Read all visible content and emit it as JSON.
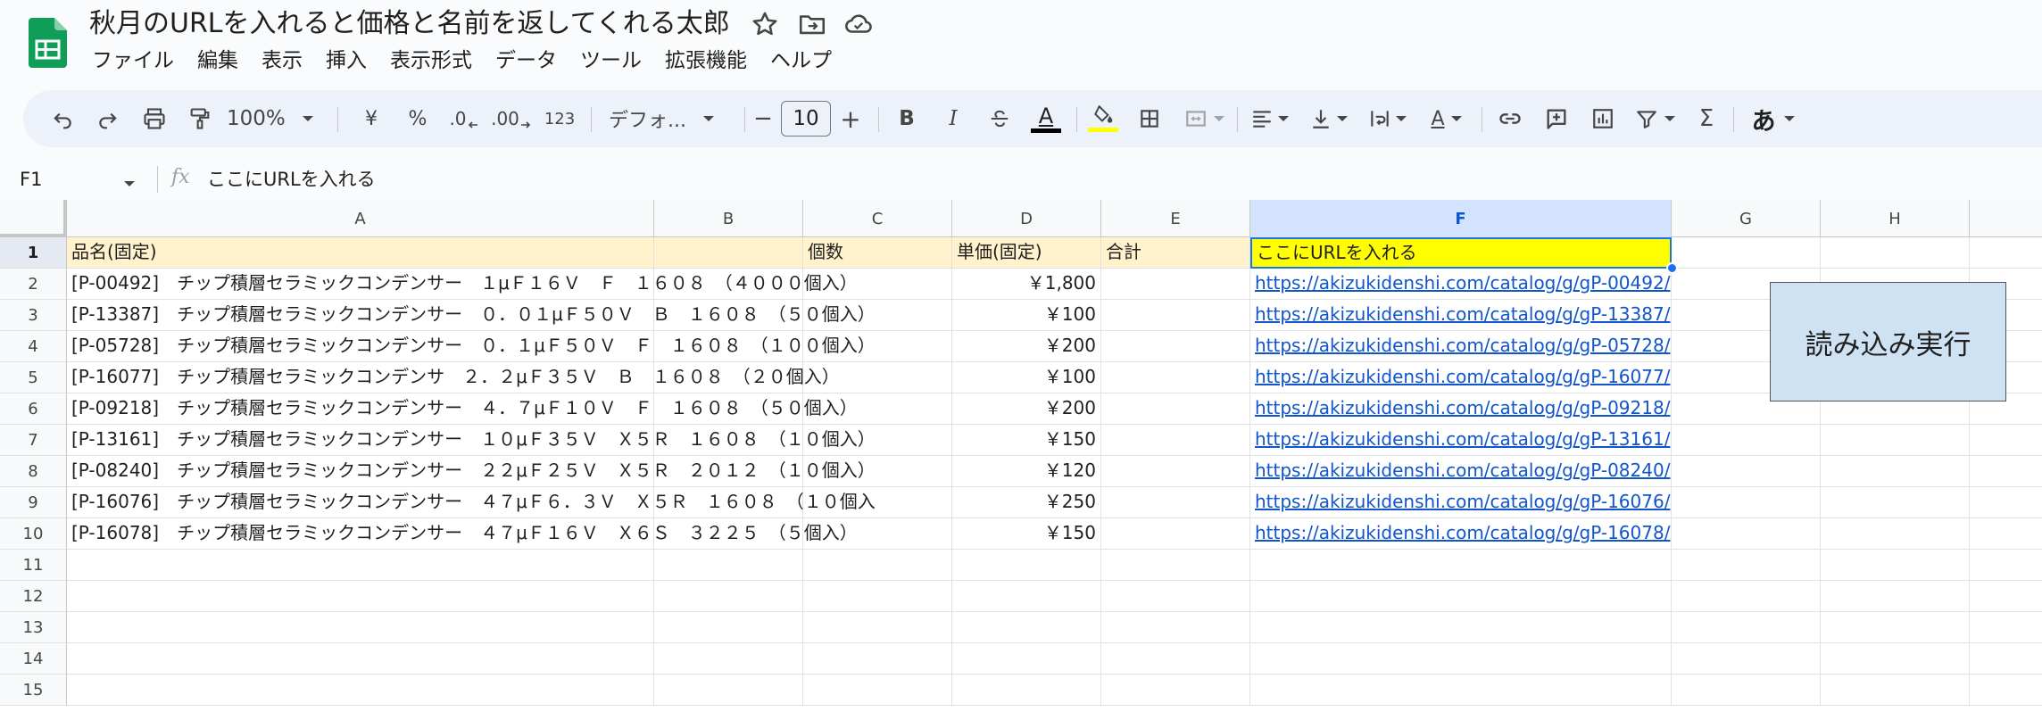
{
  "document": {
    "title": "秋月のURLを入れると価格と名前を返してくれる太郎"
  },
  "menu": [
    "ファイル",
    "編集",
    "表示",
    "挿入",
    "表示形式",
    "データ",
    "ツール",
    "拡張機能",
    "ヘルプ"
  ],
  "toolbar": {
    "zoom": "100%",
    "currency": "¥",
    "percent": "%",
    "decimal_decrease": ".0",
    "decimal_increase": ".00",
    "format_123": "123",
    "font_name": "デフォ...",
    "font_size": "10",
    "minus": "−",
    "plus": "+",
    "bold": "B",
    "italic": "I",
    "text_color_label": "A",
    "text_color": "#000000",
    "fill_color": "#ffff00",
    "rotate_label": "A",
    "sigma": "Σ",
    "input_tool": "あ"
  },
  "formula_bar": {
    "cell_ref": "F1",
    "fx": "fx",
    "value": "ここにURLを入れる"
  },
  "columns": [
    "A",
    "B",
    "C",
    "D",
    "E",
    "F",
    "G",
    "H"
  ],
  "selected_column": "F",
  "row_numbers": [
    "1",
    "2",
    "3",
    "4",
    "5",
    "6",
    "7",
    "8",
    "9",
    "10",
    "11",
    "12",
    "13",
    "14",
    "15"
  ],
  "header_row": {
    "A": "品名(固定)",
    "C": "個数",
    "D": "単価(固定)",
    "E": "合計",
    "F": "ここにURLを入れる"
  },
  "rows": [
    {
      "name": "[P-00492]　チップ積層セラミックコンデンサー　１μＦ１６Ｖ　Ｆ　１６０８　（４０００個入）",
      "price": "￥1,800",
      "url": "https://akizukidenshi.com/catalog/g/gP-00492/"
    },
    {
      "name": "[P-13387]　チップ積層セラミックコンデンサー　０．０１μＦ５０Ｖ　Ｂ　１６０８　（５０個入）",
      "price": "￥100",
      "url": "https://akizukidenshi.com/catalog/g/gP-13387/"
    },
    {
      "name": "[P-05728]　チップ積層セラミックコンデンサー　０．１μＦ５０Ｖ　Ｆ　１６０８　（１００個入）",
      "price": "￥200",
      "url": "https://akizukidenshi.com/catalog/g/gP-05728/"
    },
    {
      "name": "[P-16077]　チップ積層セラミックコンデンサ　２．２μＦ３５Ｖ　Ｂ　１６０８　（２０個入）",
      "price": "￥100",
      "url": "https://akizukidenshi.com/catalog/g/gP-16077/"
    },
    {
      "name": "[P-09218]　チップ積層セラミックコンデンサー　４．７μＦ１０Ｖ　Ｆ　１６０８　（５０個入）",
      "price": "￥200",
      "url": "https://akizukidenshi.com/catalog/g/gP-09218/"
    },
    {
      "name": "[P-13161]　チップ積層セラミックコンデンサー　１０μＦ３５Ｖ　Ｘ５Ｒ　１６０８　（１０個入）",
      "price": "￥150",
      "url": "https://akizukidenshi.com/catalog/g/gP-13161/"
    },
    {
      "name": "[P-08240]　チップ積層セラミックコンデンサー　２２μＦ２５Ｖ　Ｘ５Ｒ　２０１２　（１０個入）",
      "price": "￥120",
      "url": "https://akizukidenshi.com/catalog/g/gP-08240/"
    },
    {
      "name": "[P-16076]　チップ積層セラミックコンデンサー　４７μＦ６．３Ｖ　Ｘ５Ｒ　１６０８　（１０個入",
      "price": "￥250",
      "url": "https://akizukidenshi.com/catalog/g/gP-16076/"
    },
    {
      "name": "[P-16078]　チップ積層セラミックコンデンサー　４７μＦ１６Ｖ　Ｘ６Ｓ　３２２５　（５個入）",
      "price": "￥150",
      "url": "https://akizukidenshi.com/catalog/g/gP-16078/"
    }
  ],
  "run_button": {
    "label": "読み込み実行"
  },
  "colors": {
    "header_fill": "#fff2cc",
    "selected_fill": "#ffff00",
    "button_fill": "#cfe2f3",
    "link": "#1155cc",
    "selection": "#1a73e8"
  }
}
